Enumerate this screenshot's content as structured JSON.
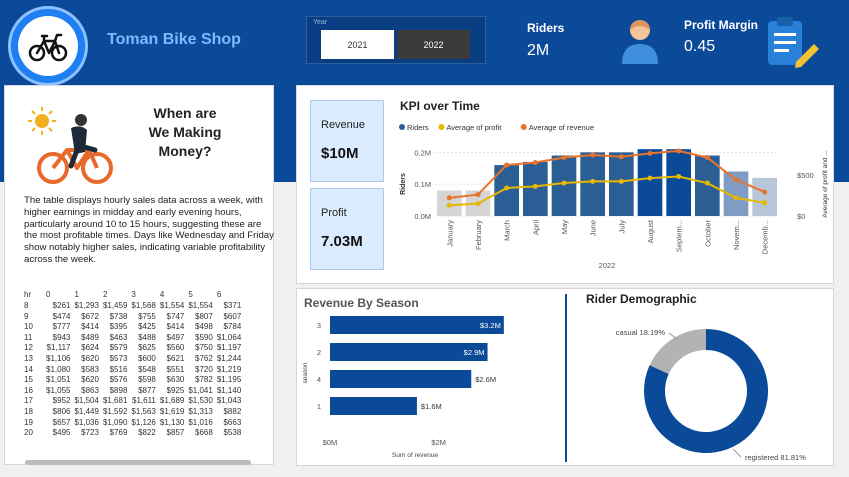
{
  "header": {
    "title": "Toman Bike Shop",
    "slicer": {
      "label": "Year",
      "options": [
        "2021",
        "2022"
      ],
      "selected": "2022"
    },
    "riders": {
      "label": "Riders",
      "value": "2M"
    },
    "profit_margin": {
      "label": "Profit Margin",
      "value": "0.45"
    }
  },
  "icons": {
    "logo": "bicycle-icon",
    "user": "user-icon",
    "clipboard": "clipboard-icon",
    "sun": "sun-icon",
    "cyclist": "cyclist-icon"
  },
  "colors": {
    "brand": "#0b4a99",
    "bar_light": "#2b5e95",
    "bar_dark": "#0b4a99",
    "profit_line": "#e6b800",
    "revenue_line": "#e8742a",
    "casual": "#b3b3b3",
    "registered": "#0b4a99"
  },
  "left_panel": {
    "headline": "When are We Making Money?",
    "description": "The table displays hourly sales data across a week, with higher earnings in midday and early evening hours, particularly around 10 to 15 hours, suggesting these are the most profitable times. Days like Wednesday and Friday show notably higher sales, indicating variable profitability across the week.",
    "table": {
      "columns": [
        "hr",
        "0",
        "1",
        "2",
        "3",
        "4",
        "5",
        "6"
      ],
      "rows": [
        [
          "8",
          "$261",
          "$1,293",
          "$1,459",
          "$1,568",
          "$1,554",
          "$1,554",
          "$371"
        ],
        [
          "9",
          "$474",
          "$672",
          "$738",
          "$755",
          "$747",
          "$807",
          "$607"
        ],
        [
          "10",
          "$777",
          "$414",
          "$395",
          "$425",
          "$414",
          "$498",
          "$784"
        ],
        [
          "11",
          "$943",
          "$489",
          "$463",
          "$488",
          "$497",
          "$590",
          "$1,064"
        ],
        [
          "12",
          "$1,117",
          "$624",
          "$579",
          "$625",
          "$560",
          "$750",
          "$1,197"
        ],
        [
          "13",
          "$1,106",
          "$620",
          "$573",
          "$600",
          "$621",
          "$762",
          "$1,244"
        ],
        [
          "14",
          "$1,080",
          "$583",
          "$516",
          "$548",
          "$551",
          "$720",
          "$1,219"
        ],
        [
          "15",
          "$1,051",
          "$620",
          "$576",
          "$598",
          "$630",
          "$782",
          "$1,195"
        ],
        [
          "16",
          "$1,055",
          "$863",
          "$898",
          "$877",
          "$925",
          "$1,041",
          "$1,140"
        ],
        [
          "17",
          "$952",
          "$1,504",
          "$1,681",
          "$1,611",
          "$1,689",
          "$1,530",
          "$1,043"
        ],
        [
          "18",
          "$806",
          "$1,449",
          "$1,592",
          "$1,563",
          "$1,619",
          "$1,313",
          "$882"
        ],
        [
          "19",
          "$657",
          "$1,036",
          "$1,090",
          "$1,126",
          "$1,130",
          "$1,016",
          "$663"
        ],
        [
          "20",
          "$495",
          "$723",
          "$769",
          "$822",
          "$857",
          "$668",
          "$538"
        ]
      ]
    }
  },
  "kpi_cards": {
    "revenue": {
      "label": "Revenue",
      "value": "$10M"
    },
    "profit": {
      "label": "Profit",
      "value": "7.03M"
    }
  },
  "kpi_chart": {
    "title": "KPI over Time",
    "legend": [
      "Riders",
      "Average of profit",
      "Average of revenue"
    ]
  },
  "season_chart": {
    "title": "Revenue By Season"
  },
  "demographic_chart": {
    "title": "Rider Demographic"
  },
  "chart_data": [
    {
      "type": "bar",
      "title": "KPI over Time",
      "xlabel": "2022",
      "ylabel": "Riders",
      "y2label": "Average of profit and ...",
      "categories": [
        "January",
        "February",
        "March",
        "April",
        "May",
        "June",
        "July",
        "August",
        "Septem...",
        "October",
        "Novem...",
        "Decemb..."
      ],
      "series": [
        {
          "name": "Riders",
          "kind": "bar",
          "axis": "left",
          "values": [
            0.08,
            0.08,
            0.16,
            0.17,
            0.19,
            0.2,
            0.2,
            0.21,
            0.21,
            0.19,
            0.14,
            0.12
          ]
        },
        {
          "name": "Average of profit",
          "kind": "line",
          "axis": "right",
          "values": [
            130,
            150,
            340,
            360,
            400,
            420,
            420,
            460,
            480,
            400,
            220,
            160
          ]
        },
        {
          "name": "Average of revenue",
          "kind": "line",
          "axis": "right",
          "values": [
            220,
            260,
            620,
            650,
            710,
            740,
            720,
            760,
            790,
            710,
            440,
            290
          ]
        }
      ],
      "yticks": [
        "0.0M",
        "0.1M",
        "0.2M"
      ],
      "ylim": [
        0,
        0.22
      ],
      "y2ticks": [
        "$0",
        "$500"
      ],
      "y2lim": [
        0,
        850
      ],
      "legend_position": "top-left"
    },
    {
      "type": "bar",
      "orientation": "horizontal",
      "title": "Revenue By Season",
      "xlabel": "Sum of revenue",
      "ylabel": "season",
      "categories": [
        "3",
        "2",
        "4",
        "1"
      ],
      "values": [
        3.2,
        2.9,
        2.6,
        1.6
      ],
      "data_labels": [
        "$3.2M",
        "$2.9M",
        "$2.6M",
        "$1.6M"
      ],
      "xticks": [
        "$0M",
        "$2M"
      ],
      "xlim": [
        0,
        3.7
      ]
    },
    {
      "type": "pie",
      "variant": "donut",
      "title": "Rider Demographic",
      "categories": [
        "casual",
        "registered"
      ],
      "values": [
        18.19,
        81.81
      ],
      "data_labels": [
        "casual 18.19%",
        "registered 81.81%"
      ]
    }
  ]
}
